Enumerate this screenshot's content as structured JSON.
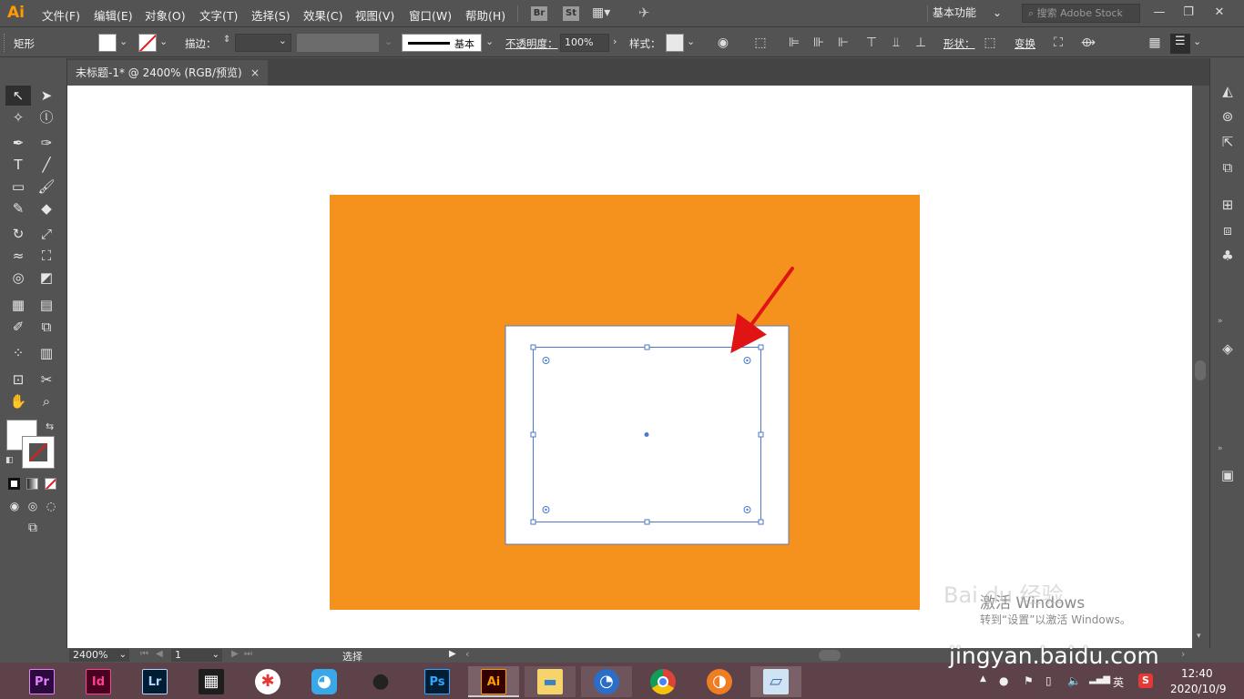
{
  "app": {
    "logo": "Ai",
    "accent": "#ff9a00"
  },
  "menu": [
    "文件(F)",
    "编辑(E)",
    "对象(O)",
    "文字(T)",
    "选择(S)",
    "效果(C)",
    "视图(V)",
    "窗口(W)",
    "帮助(H)"
  ],
  "app_icons": {
    "bridge": "Br",
    "stock": "St"
  },
  "workspace": {
    "label": "基本功能"
  },
  "search": {
    "placeholder": "搜索 Adobe Stock"
  },
  "control": {
    "object_type": "矩形",
    "stroke_label": "描边：",
    "brush_label": "基本",
    "opacity_label": "不透明度：",
    "opacity_value": "100%",
    "style_label": "样式：",
    "shape_label": "形状：",
    "transform_label": "变换"
  },
  "document": {
    "tab_title": "未标题-1* @ 2400% (RGB/预览)",
    "close": "×"
  },
  "artboard": {
    "background": "#f5921e",
    "inner_fill": "#ffffff",
    "selection_color": "#4a7ac8"
  },
  "status": {
    "zoom": "2400%",
    "page": "1",
    "tool": "选择"
  },
  "watermark": {
    "activate_line1": "激活 Windows",
    "activate_line2": "转到“设置”以激活 Windows。",
    "site": "jingyan.baidu.com",
    "brand": "Bai du 经验"
  },
  "taskbar": {
    "apps": [
      {
        "name": "premiere",
        "label": "Pr",
        "color": "#e77dff",
        "bg": "#2b0a3d"
      },
      {
        "name": "indesign",
        "label": "Id",
        "color": "#ff3f94",
        "bg": "#49021f"
      },
      {
        "name": "lightroom",
        "label": "Lr",
        "color": "#b2d4ff",
        "bg": "#001d34"
      },
      {
        "name": "film",
        "label": "▦",
        "color": "#ffffff",
        "bg": "#1e1e1e"
      },
      {
        "name": "pinwheel",
        "label": "✱",
        "color": "#e53935",
        "bg": "#ffffff"
      },
      {
        "name": "bird",
        "label": "◕",
        "color": "#ffffff",
        "bg": "#3aa7e8"
      },
      {
        "name": "qq",
        "label": "●",
        "color": "#222222",
        "bg": "#f2f2f2"
      },
      {
        "name": "photoshop",
        "label": "Ps",
        "color": "#31a8ff",
        "bg": "#001e36"
      },
      {
        "name": "illustrator",
        "label": "Ai",
        "color": "#ff9a00",
        "bg": "#330000"
      },
      {
        "name": "explorer",
        "label": "▬",
        "color": "#3a82c4",
        "bg": "#f6d36b"
      },
      {
        "name": "browser-blue",
        "label": "◔",
        "color": "#ffffff",
        "bg": "#2a6ec8"
      },
      {
        "name": "chrome",
        "label": "◎",
        "color": "#ffffff",
        "bg": "#db4437"
      },
      {
        "name": "orange-app",
        "label": "◑",
        "color": "#ffffff",
        "bg": "#f07d21"
      },
      {
        "name": "notebook",
        "label": "▱",
        "color": "#3a6ea5",
        "bg": "#cfe3f5"
      }
    ],
    "ime": "英",
    "time": "12:40",
    "date": "2020/10/9"
  }
}
